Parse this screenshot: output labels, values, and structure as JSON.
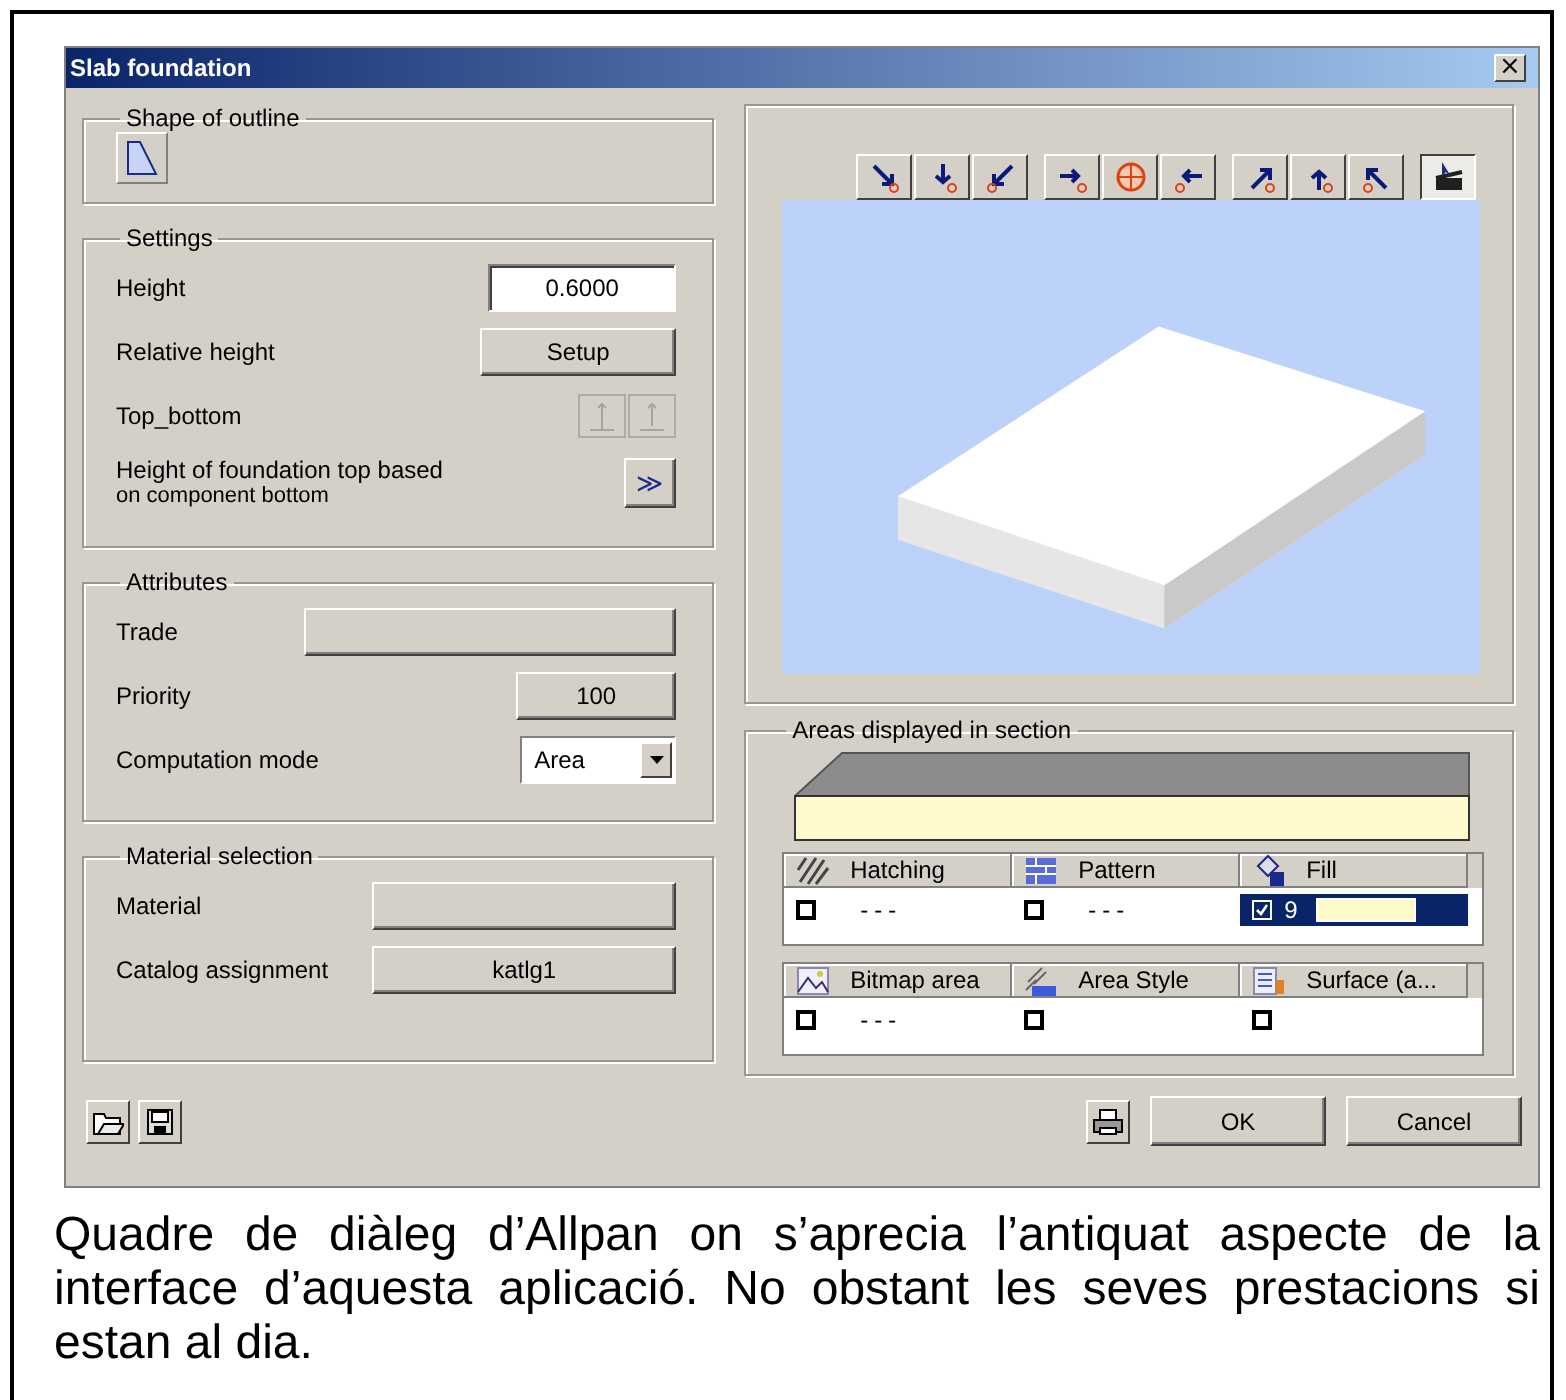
{
  "window": {
    "title": "Slab foundation",
    "close": "×"
  },
  "shape_of_outline": {
    "title": "Shape of outline"
  },
  "settings": {
    "title": "Settings",
    "rows": [
      {
        "kind": "field",
        "label": "Height",
        "value": "0.6000"
      },
      {
        "kind": "button",
        "label": "Relative height",
        "button": "Setup"
      },
      {
        "kind": "toggles",
        "label": "Top_bottom",
        "disabled": true
      },
      {
        "kind": "more",
        "label": "Height of foundation top based",
        "sublabel": "on component bottom",
        "button": "≫"
      }
    ]
  },
  "attributes": {
    "title": "Attributes",
    "rows": [
      {
        "kind": "button",
        "label": "Trade"
      },
      {
        "kind": "button",
        "label": "Priority",
        "button": "100"
      },
      {
        "kind": "dropdown",
        "label": "Computation mode",
        "value": "Area"
      }
    ]
  },
  "material_selection": {
    "title": "Material selection",
    "rows": [
      {
        "kind": "button",
        "label": "Material"
      },
      {
        "kind": "button",
        "label": "Catalog assignment",
        "button": "katlg1"
      }
    ]
  },
  "view_buttons": [
    {
      "selected": false
    },
    {
      "selected": false
    },
    {
      "selected": false
    },
    {
      "selected": false
    },
    {
      "selected": false
    },
    {
      "selected": false
    },
    {
      "selected": false
    },
    {
      "selected": false
    },
    {
      "selected": false
    },
    {
      "selected": true
    }
  ],
  "areas": {
    "title": "Areas displayed in section",
    "groups": [
      [
        {
          "label": "Hatching",
          "checked": false,
          "value": "---",
          "selected": false
        },
        {
          "label": "Pattern",
          "checked": false,
          "value": "---",
          "selected": false
        },
        {
          "label": "Fill",
          "checked": true,
          "value": "9",
          "selected": true,
          "color": "#fff8c8"
        }
      ],
      [
        {
          "label": "Bitmap area",
          "checked": false,
          "value": "---",
          "selected": false
        },
        {
          "label": "Area Style",
          "checked": false,
          "selected": false
        },
        {
          "label": "Surface (a...",
          "checked": false,
          "selected": false
        }
      ]
    ]
  },
  "buttons": [
    "OK",
    "Cancel"
  ],
  "caption": "Quadre de diàleg d’Allpan on s’aprecia l’antiquat aspecte de la interface d’aquesta aplicació. No obstant les seves prestacions si estan al dia."
}
